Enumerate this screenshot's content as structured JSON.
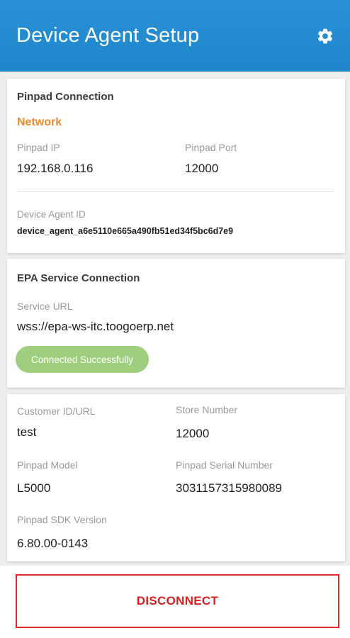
{
  "header": {
    "title": "Device Agent Setup",
    "settings_icon": "gear-icon",
    "background_color": "#1f86cc"
  },
  "pinpad_connection": {
    "title": "Pinpad Connection",
    "mode": "Network",
    "pinpad_ip_label": "Pinpad IP",
    "pinpad_ip_value": "192.168.0.116",
    "pinpad_port_label": "Pinpad Port",
    "pinpad_port_value": "12000",
    "device_agent_id_label": "Device Agent ID",
    "device_agent_id_value": "device_agent_a6e5110e665a490fb51ed34f5bc6d7e9"
  },
  "epa_service": {
    "title": "EPA Service Connection",
    "service_url_label": "Service URL",
    "service_url_value": "wss://epa-ws-itc.toogoerp.net",
    "status": "Connected Successfully",
    "status_color": "#9fcf7e"
  },
  "device_info": {
    "customer_id_label": "Customer ID/URL",
    "customer_id_value": "test",
    "store_number_label": "Store Number",
    "store_number_value": "12000",
    "pinpad_model_label": "Pinpad Model",
    "pinpad_model_value": "L5000",
    "pinpad_serial_label": "Pinpad Serial Number",
    "pinpad_serial_value": "3031157315980089",
    "sdk_version_label": "Pinpad SDK Version",
    "sdk_version_value": "6.80.00-0143"
  },
  "actions": {
    "disconnect_label": "DISCONNECT",
    "disconnect_color": "#d92020"
  }
}
